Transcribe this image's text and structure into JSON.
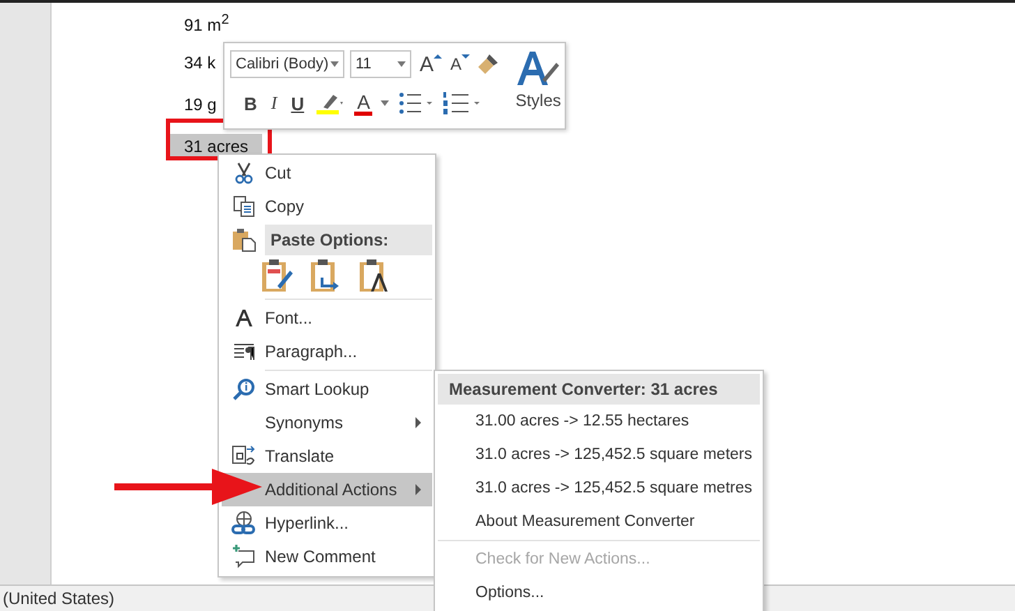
{
  "document": {
    "lines": [
      {
        "text": "91 m$^{2}$",
        "selected": false
      },
      {
        "text": "34 k",
        "selected": false
      },
      {
        "text": "19 g",
        "selected": false
      },
      {
        "text": "31 acres",
        "selected": true
      }
    ]
  },
  "mini_toolbar": {
    "font_name": "Calibri (Body)",
    "font_size": "11",
    "grow_font": "A",
    "shrink_font": "A",
    "bold": "B",
    "italic": "I",
    "underline": "U",
    "font_color": "A",
    "styles": "Styles"
  },
  "context_menu": {
    "items": [
      {
        "kind": "item",
        "label": "Cut",
        "selected": false,
        "submenu": false
      },
      {
        "kind": "item",
        "label": "Copy",
        "selected": false,
        "submenu": false
      },
      {
        "kind": "header",
        "label": "Paste Options:"
      },
      {
        "kind": "paste_options"
      },
      {
        "kind": "divider"
      },
      {
        "kind": "item",
        "label": "Font...",
        "selected": false,
        "submenu": false
      },
      {
        "kind": "item",
        "label": "Paragraph...",
        "selected": false,
        "submenu": false
      },
      {
        "kind": "divider"
      },
      {
        "kind": "item",
        "label": "Smart Lookup",
        "selected": false,
        "submenu": false
      },
      {
        "kind": "item",
        "label": "Synonyms",
        "selected": false,
        "submenu": true
      },
      {
        "kind": "item",
        "label": "Translate",
        "selected": false,
        "submenu": false
      },
      {
        "kind": "item",
        "label": "Additional Actions",
        "selected": true,
        "submenu": true
      },
      {
        "kind": "item",
        "label": "Hyperlink...",
        "selected": false,
        "submenu": false
      },
      {
        "kind": "item",
        "label": "New Comment",
        "selected": false,
        "submenu": false
      }
    ]
  },
  "submenu": {
    "items": [
      {
        "kind": "header",
        "label": "Measurement Converter: 31 acres"
      },
      {
        "kind": "item",
        "label": "31.00 acres -> 12.55 hectares",
        "disabled": false
      },
      {
        "kind": "item",
        "label": "31.0 acres -> 125,452.5 square meters",
        "disabled": false
      },
      {
        "kind": "item",
        "label": "31.0 acres -> 125,452.5 square metres",
        "disabled": false
      },
      {
        "kind": "item",
        "label": "About Measurement Converter",
        "disabled": false
      },
      {
        "kind": "divider"
      },
      {
        "kind": "item",
        "label": "Check for New Actions...",
        "disabled": true
      },
      {
        "kind": "item",
        "label": "Options...",
        "disabled": false
      }
    ]
  },
  "status_bar": {
    "text": "(United States)"
  }
}
